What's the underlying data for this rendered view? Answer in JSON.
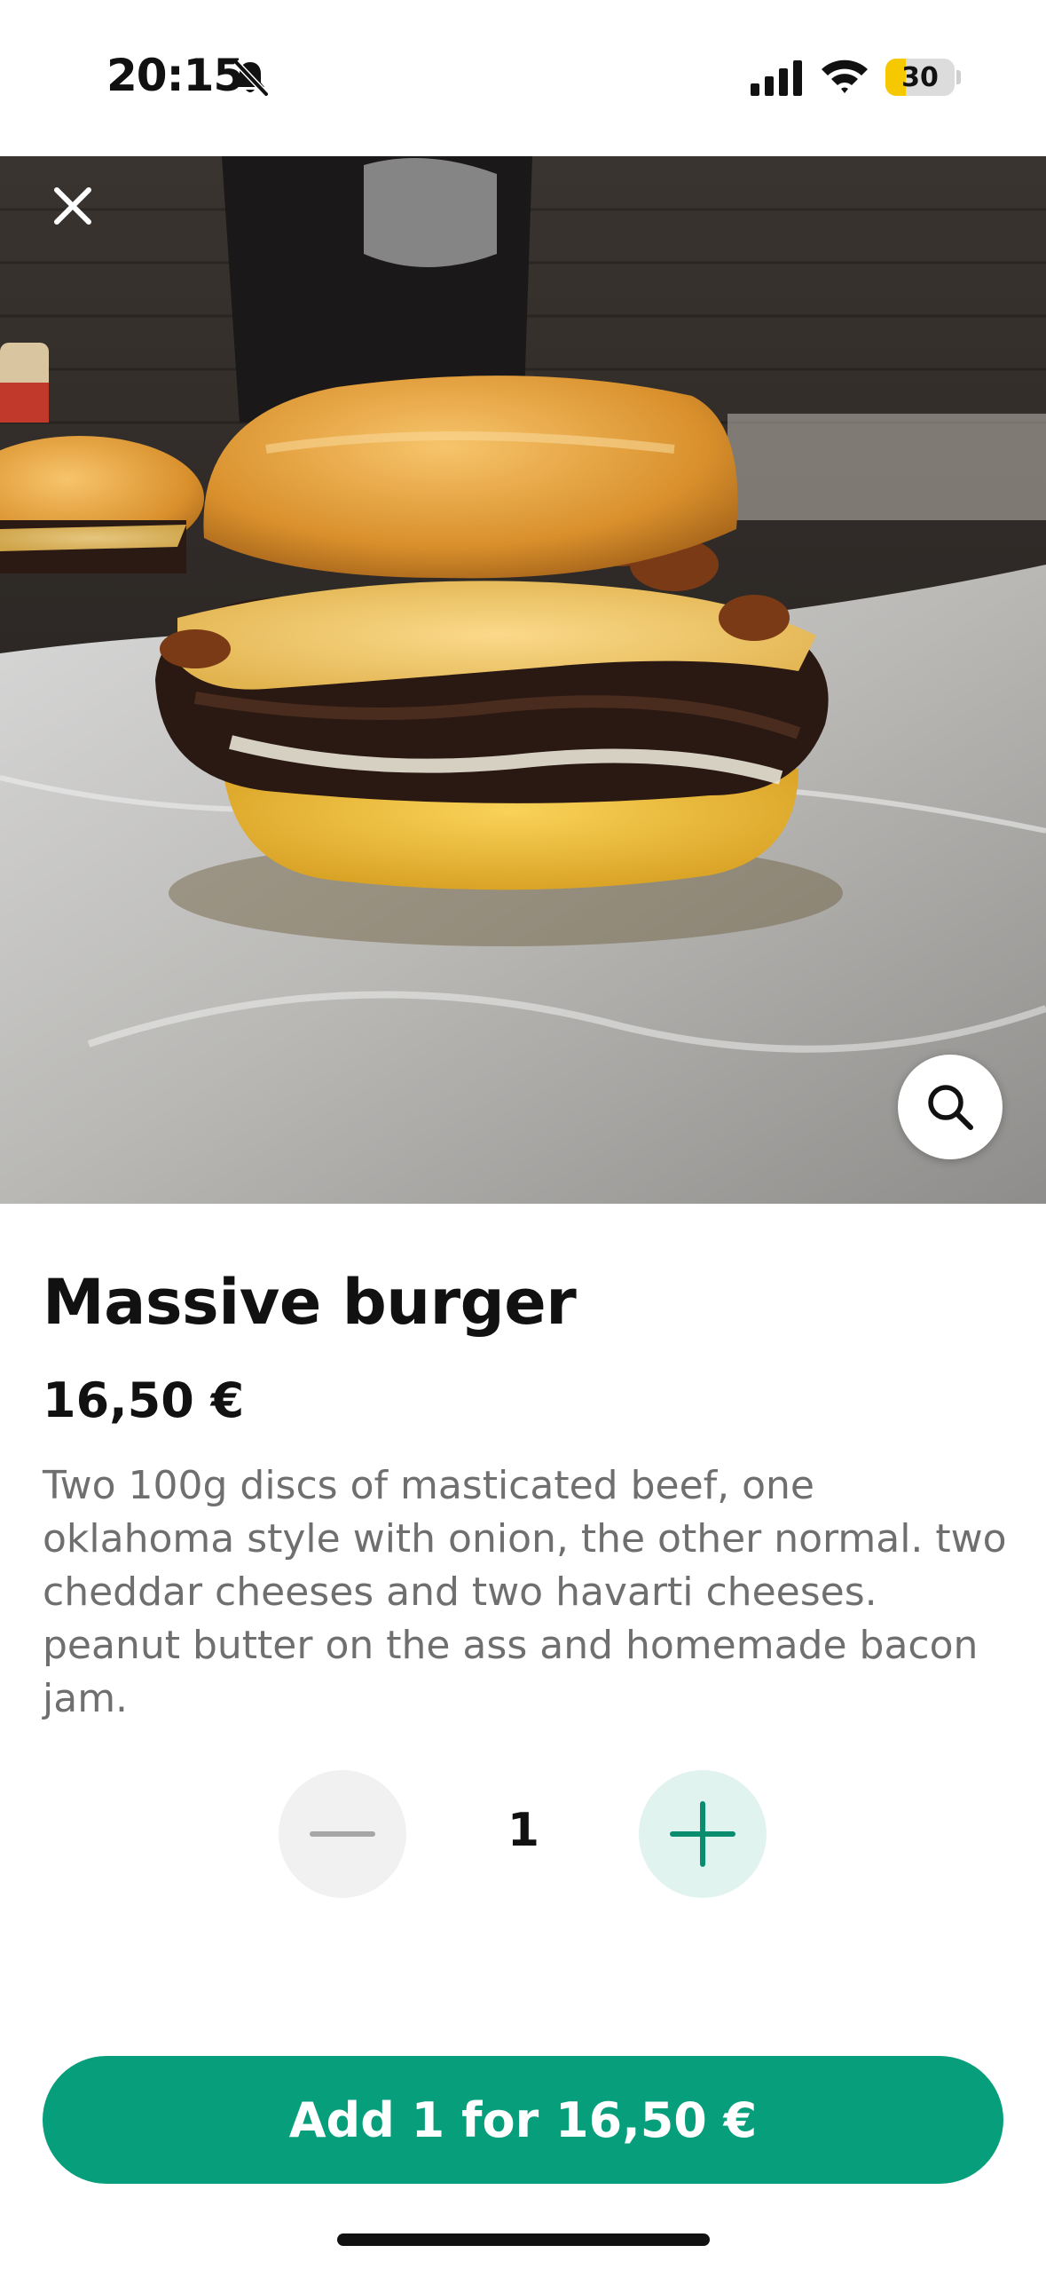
{
  "status_bar": {
    "time": "20:15",
    "bell_icon": "bell-slash-icon",
    "signal_icon": "cellular-signal-icon",
    "wifi_icon": "wifi-icon",
    "battery_level": "30",
    "battery_color": "#f5c800"
  },
  "hero": {
    "close_icon": "close-icon",
    "zoom_icon": "search-icon"
  },
  "product": {
    "title": "Massive burger",
    "price": "16,50 €",
    "description": "Two 100g discs of masticated beef, one oklahoma style with onion, the other normal. two cheddar cheeses and two havarti cheeses. peanut butter on the ass and homemade bacon jam."
  },
  "quantity": {
    "value": "1",
    "minus_icon": "minus-icon",
    "plus_icon": "plus-icon"
  },
  "add_button": {
    "label": "Add 1 for 16,50 €",
    "color": "#079e7b"
  }
}
